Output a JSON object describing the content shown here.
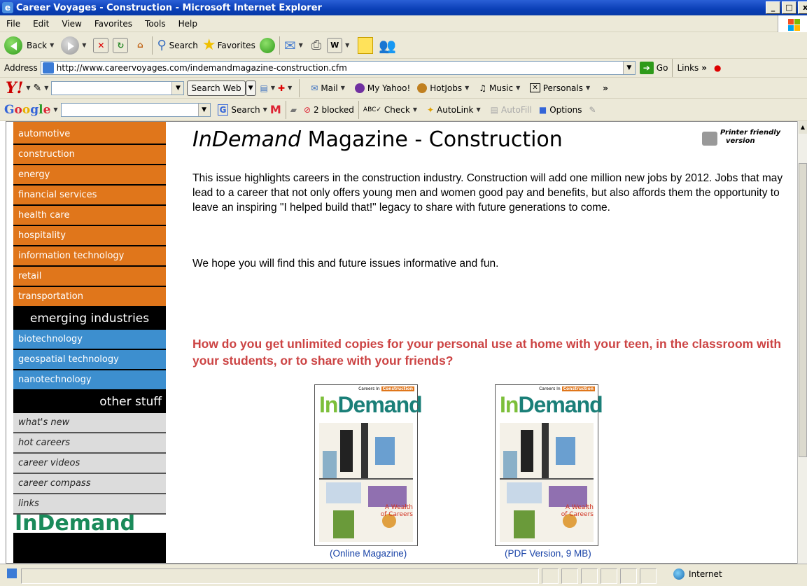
{
  "window": {
    "title": "Career Voyages - Construction - Microsoft Internet Explorer",
    "min": "_",
    "max": "□",
    "close": "x"
  },
  "menu": [
    "File",
    "Edit",
    "View",
    "Favorites",
    "Tools",
    "Help"
  ],
  "toolbar": {
    "back": "Back",
    "search": "Search",
    "favorites": "Favorites"
  },
  "address": {
    "label": "Address",
    "url": "http://www.careervoyages.com/indemandmagazine-construction.cfm",
    "go": "Go",
    "links": "Links"
  },
  "yahoo": {
    "logo": "Y!",
    "search_btn": "Search Web",
    "mail": "Mail",
    "my_yahoo": "My Yahoo!",
    "hotjobs": "HotJobs",
    "music": "Music",
    "personals": "Personals"
  },
  "google": {
    "logo": "Google",
    "search": "Search",
    "blocked": "2 blocked",
    "check": "Check",
    "autolink": "AutoLink",
    "autofill": "AutoFill",
    "options": "Options"
  },
  "sidebar": {
    "industries": [
      "automotive",
      "construction",
      "energy",
      "financial services",
      "health care",
      "hospitality",
      "information technology",
      "retail",
      "transportation"
    ],
    "emerging_heading": "emerging industries",
    "emerging": [
      "biotechnology",
      "geospatial technology",
      "nanotechnology"
    ],
    "other_heading": "other stuff",
    "other": [
      "what's new",
      "hot careers",
      "career videos",
      "career compass",
      "links"
    ],
    "logo_text": "InDemand"
  },
  "main": {
    "title_em": "InDemand",
    "title_rest": " Magazine  - Construction",
    "printer_line1": "Printer friendly",
    "printer_line2": "version",
    "p1": "This issue highlights careers in the construction industry. Construction will add one million new jobs by 2012. Jobs that may lead to a career that not only offers young men and women good pay and benefits, but also affords them the opportunity to leave an inspiring \"I helped build that!\" legacy to share with future generations to come.",
    "p2": "We hope you will find this and future issues informative and fun.",
    "question": "How do you get unlimited copies for your personal use at home with your teen, in the classroom with your students, or to share with your friends?",
    "mag_brand_in": "In",
    "mag_brand_demand": "Demand",
    "mag_tag_pre": "Careers In",
    "mag_tag": "Construction",
    "mag_wealth_1": "A Wealth",
    "mag_wealth_2": "of Careers",
    "link_online": "(Online Magazine)",
    "link_pdf": "(PDF Version, 9 MB)"
  },
  "status": {
    "zone": "Internet"
  },
  "colors": {
    "industry": "#e0761b",
    "emerging": "#3d8fcf",
    "question": "#cc4444",
    "link": "#1a44a8"
  }
}
